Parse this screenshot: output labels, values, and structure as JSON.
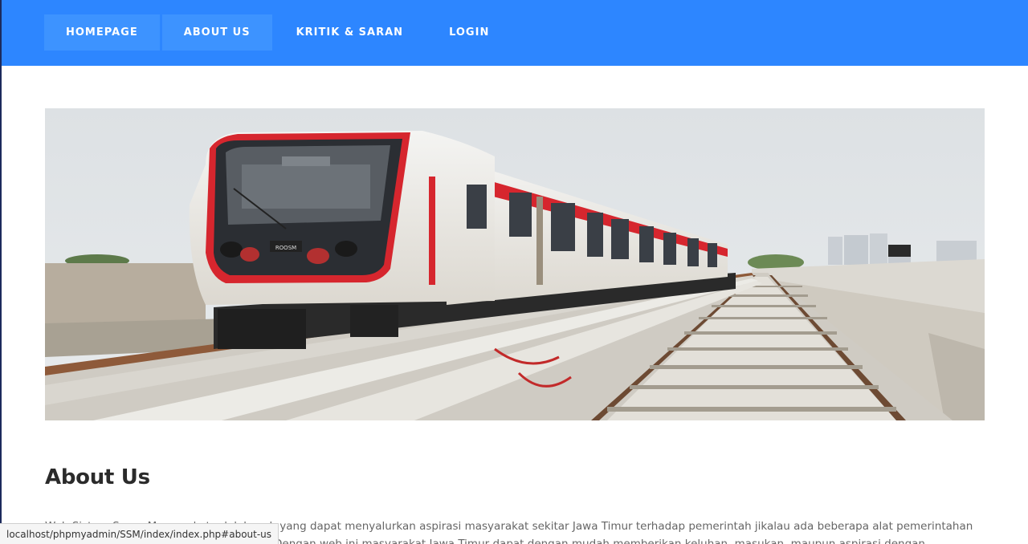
{
  "nav": {
    "items": [
      {
        "label": "HOMEPAGE"
      },
      {
        "label": "ABOUT US"
      },
      {
        "label": "KRITIK & SARAN"
      },
      {
        "label": "LOGIN"
      }
    ]
  },
  "hero": {
    "image": "train-on-elevated-track",
    "train_plate": "ROOSM"
  },
  "about": {
    "heading": "About Us",
    "paragraph": "Web Sistem Suara Masyarakat adalah web yang dapat menyalurkan aspirasi masyarakat sekitar Jawa Timur terhadap pemerintah jikalau ada beberapa alat pemerintahan yang tidak berfungsi dengan semestinya. Dengan web ini masyarakat Jawa Timur dapat dengan mudah memberikan keluhan, masukan, maupun aspirasi dengan pemerintah."
  },
  "status_bar": {
    "url": "localhost/phpmyadmin/SSM/index/index.php#about-us"
  },
  "colors": {
    "nav_bg": "#2d86ff",
    "nav_active": "#3d93ff",
    "train_red": "#d6262e"
  }
}
